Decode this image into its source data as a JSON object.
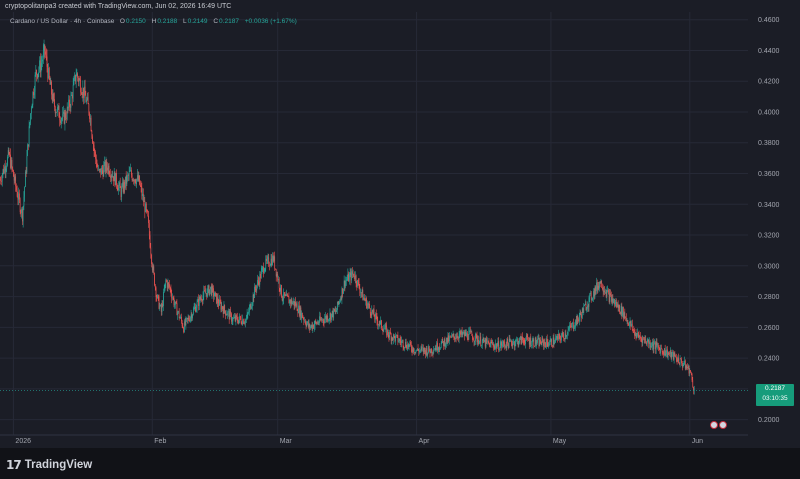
{
  "header": {
    "attribution": "cryptopolitanpa3 created with TradingView.com, Jun 02, 2026 16:49 UTC"
  },
  "symbol_bar": {
    "symbol": "Cardano / US Dollar · 4h · Coinbase",
    "o_label": "O",
    "o_value": "0.2150",
    "h_label": "H",
    "h_value": "0.2188",
    "l_label": "L",
    "l_value": "0.2149",
    "c_label": "C",
    "c_value": "0.2187",
    "change": "+0.0036 (+1.67%)"
  },
  "price_tag": {
    "price": "0.2187",
    "countdown": "03:10:35"
  },
  "footer": {
    "brand": "TradingView"
  },
  "colors": {
    "background": "#1b1d26",
    "up": "#26a69a",
    "down": "#ef5350",
    "grid": "#262936",
    "axis_text": "#a3a6af"
  },
  "chart_data": {
    "type": "line",
    "title": "",
    "xlabel": "",
    "ylabel": "",
    "ylim": [
      0.19,
      0.465
    ],
    "y_ticks": [
      "0.4600",
      "0.4400",
      "0.4200",
      "0.4000",
      "0.3800",
      "0.3600",
      "0.3400",
      "0.3200",
      "0.3000",
      "0.2800",
      "0.2600",
      "0.2400",
      "0.2200",
      "0.2000"
    ],
    "y_tick_values": [
      0.46,
      0.44,
      0.42,
      0.4,
      0.38,
      0.36,
      0.34,
      0.32,
      0.3,
      0.28,
      0.26,
      0.24,
      0.22,
      0.2
    ],
    "x_ticks": [
      "2026",
      "Feb",
      "Mar",
      "Apr",
      "May",
      "Jun"
    ],
    "x_tick_dates": [
      "2026-01-01",
      "2026-02-01",
      "2026-03-01",
      "2026-04-01",
      "2026-05-01",
      "2026-06-01"
    ],
    "x_range": [
      "2025-12-29",
      "2026-06-14"
    ],
    "grid": true,
    "series": [
      {
        "values_date": [
          "2025-12-29",
          "2025-12-31",
          "2026-01-02",
          "2026-01-03",
          "2026-01-04",
          "2026-01-05",
          "2026-01-06",
          "2026-01-07",
          "2026-01-08",
          "2026-01-09",
          "2026-01-10",
          "2026-01-12",
          "2026-01-13",
          "2026-01-14",
          "2026-01-15",
          "2026-01-16",
          "2026-01-17",
          "2026-01-18",
          "2026-01-19",
          "2026-01-20",
          "2026-01-22",
          "2026-01-24",
          "2026-01-25",
          "2026-01-27",
          "2026-01-29",
          "2026-01-31",
          "2026-02-01",
          "2026-02-02",
          "2026-02-03",
          "2026-02-04",
          "2026-02-05",
          "2026-02-06",
          "2026-02-08",
          "2026-02-10",
          "2026-02-12",
          "2026-02-14",
          "2026-02-16",
          "2026-02-19",
          "2026-02-22",
          "2026-02-24",
          "2026-02-26",
          "2026-02-28",
          "2026-03-02",
          "2026-03-05",
          "2026-03-08",
          "2026-03-11",
          "2026-03-14",
          "2026-03-16",
          "2026-03-18",
          "2026-03-20",
          "2026-03-23",
          "2026-03-26",
          "2026-03-29",
          "2026-04-01",
          "2026-04-04",
          "2026-04-07",
          "2026-04-10",
          "2026-04-13",
          "2026-04-16",
          "2026-04-19",
          "2026-04-22",
          "2026-04-25",
          "2026-04-28",
          "2026-05-01",
          "2026-05-04",
          "2026-05-07",
          "2026-05-10",
          "2026-05-12",
          "2026-05-14",
          "2026-05-17",
          "2026-05-20",
          "2026-05-23",
          "2026-05-26",
          "2026-05-29",
          "2026-05-31",
          "2026-06-01",
          "2026-06-02"
        ],
        "values": [
          0.356,
          0.372,
          0.345,
          0.333,
          0.37,
          0.405,
          0.425,
          0.43,
          0.44,
          0.42,
          0.405,
          0.395,
          0.4,
          0.41,
          0.425,
          0.418,
          0.41,
          0.4,
          0.375,
          0.36,
          0.365,
          0.355,
          0.348,
          0.36,
          0.355,
          0.33,
          0.3,
          0.28,
          0.27,
          0.29,
          0.285,
          0.275,
          0.26,
          0.27,
          0.28,
          0.285,
          0.275,
          0.265,
          0.265,
          0.285,
          0.3,
          0.305,
          0.28,
          0.275,
          0.26,
          0.265,
          0.27,
          0.29,
          0.295,
          0.28,
          0.265,
          0.255,
          0.25,
          0.245,
          0.245,
          0.25,
          0.255,
          0.255,
          0.25,
          0.248,
          0.25,
          0.252,
          0.25,
          0.25,
          0.255,
          0.265,
          0.28,
          0.29,
          0.28,
          0.27,
          0.255,
          0.25,
          0.245,
          0.24,
          0.235,
          0.232,
          0.219
        ]
      }
    ]
  }
}
